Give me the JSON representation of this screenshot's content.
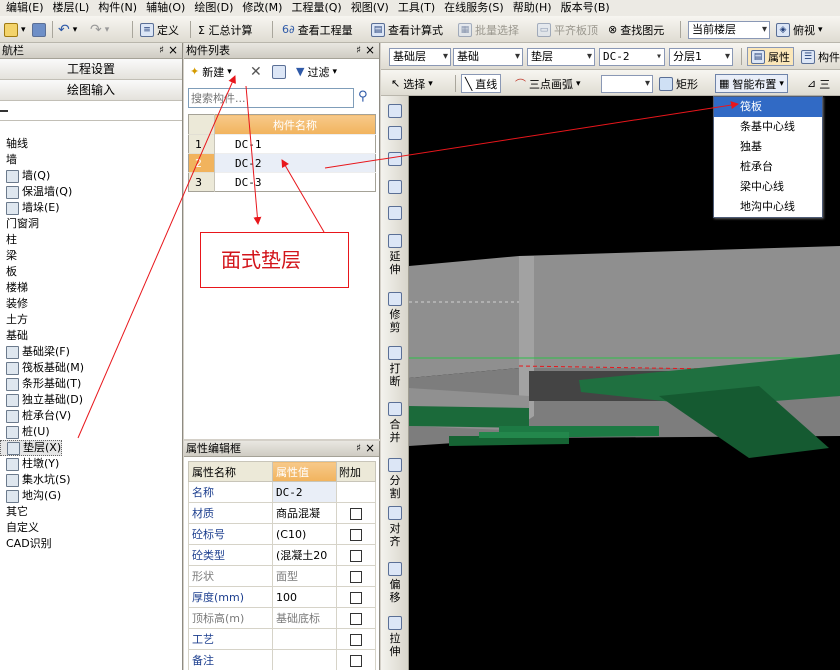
{
  "menu": [
    "编辑(E)",
    "楼层(L)",
    "构件(N)",
    "辅轴(O)",
    "绘图(D)",
    "修改(M)",
    "工程量(Q)",
    "视图(V)",
    "工具(T)",
    "在线服务(S)",
    "帮助(H)",
    "版本号(B)"
  ],
  "toolbar": {
    "define": "定义",
    "sum": "Σ 汇总计算",
    "view_quantity": "查看工程量",
    "view_formula": "查看计算式",
    "batch_select": "批量选择",
    "flat_slab": "平齐板顶",
    "find_element": "查找图元",
    "floor_combo": "当前楼层",
    "view_mode": "俯视"
  },
  "toolbar2": {
    "layer1": "基础层",
    "layer2": "基础",
    "component_type": "垫层",
    "component": "DC-2",
    "layer": "分层1",
    "property": "属性",
    "component_list": "构件"
  },
  "toolbar3": {
    "select": "选择",
    "line": "直线",
    "arc": "三点画弧",
    "rect": "矩形",
    "smart_layout": "智能布置",
    "more": "三"
  },
  "smart_menu": {
    "items": [
      "筏板",
      "条基中心线",
      "独基",
      "桩承台",
      "梁中心线",
      "地沟中心线"
    ],
    "highlighted": 0
  },
  "nav": {
    "title": "航栏",
    "pin": "♯",
    "close": "×",
    "btn_project": "工程设置",
    "btn_drawing": "绘图输入",
    "tree": [
      {
        "label": "轴线",
        "depth": 0
      },
      {
        "label": "墙",
        "depth": 0
      },
      {
        "label": "墙(Q)",
        "depth": 1
      },
      {
        "label": "保温墙(Q)",
        "depth": 1
      },
      {
        "label": "墙垛(E)",
        "depth": 1
      },
      {
        "label": "门窗洞",
        "depth": 0
      },
      {
        "label": "柱",
        "depth": 0
      },
      {
        "label": "梁",
        "depth": 0
      },
      {
        "label": "板",
        "depth": 0
      },
      {
        "label": "楼梯",
        "depth": 0
      },
      {
        "label": "装修",
        "depth": 0
      },
      {
        "label": "土方",
        "depth": 0
      },
      {
        "label": "基础",
        "depth": 0
      },
      {
        "label": "基础梁(F)",
        "depth": 1
      },
      {
        "label": "筏板基础(M)",
        "depth": 1
      },
      {
        "label": "条形基础(T)",
        "depth": 1
      },
      {
        "label": "独立基础(D)",
        "depth": 1
      },
      {
        "label": "桩承台(V)",
        "depth": 1
      },
      {
        "label": "桩(U)",
        "depth": 1
      },
      {
        "label": "垫层(X)",
        "depth": 1
      },
      {
        "label": "柱墩(Y)",
        "depth": 1
      },
      {
        "label": "集水坑(S)",
        "depth": 1
      },
      {
        "label": "地沟(G)",
        "depth": 1
      },
      {
        "label": "其它",
        "depth": 0
      },
      {
        "label": "自定义",
        "depth": 0
      },
      {
        "label": "CAD识别",
        "depth": 0
      }
    ],
    "selected_index": 19
  },
  "complist": {
    "title": "构件列表",
    "new_btn": "新建",
    "filter_btn": "过滤",
    "search_placeholder": "搜索构件...",
    "header": "构件名称",
    "rows": [
      {
        "num": "1",
        "name": "DC-1"
      },
      {
        "num": "2",
        "name": "DC-2"
      },
      {
        "num": "3",
        "name": "DC-3"
      }
    ],
    "selected_index": 1
  },
  "props": {
    "title": "属性编辑框",
    "headers": [
      "属性名称",
      "属性值",
      "附加"
    ],
    "rows": [
      {
        "name": "名称",
        "value": "DC-2",
        "check": false,
        "blue": true
      },
      {
        "name": "材质",
        "value": "商品混凝",
        "check": true,
        "blue": true
      },
      {
        "name": "砼标号",
        "value": "(C10)",
        "check": true,
        "blue": true
      },
      {
        "name": "砼类型",
        "value": "(混凝土20",
        "check": true,
        "blue": true
      },
      {
        "name": "形状",
        "value": "面型",
        "check": true,
        "blue": false
      },
      {
        "name": "厚度(mm)",
        "value": "100",
        "check": true,
        "blue": true
      },
      {
        "name": "顶标高(m)",
        "value": "基础底标",
        "check": true,
        "blue": false
      },
      {
        "name": "工艺",
        "value": "",
        "check": true,
        "blue": true
      },
      {
        "name": "备注",
        "value": "",
        "check": true,
        "blue": true
      }
    ]
  },
  "vtool": [
    "延伸",
    "修剪",
    "打断",
    "合并",
    "分割",
    "对齐",
    "偏移",
    "拉伸"
  ],
  "annotation": "面式垫层",
  "colors": {
    "arrow": "#e8161b",
    "highlight": "#316ac5",
    "slab": "#888888",
    "green": "#1e6b3c"
  }
}
